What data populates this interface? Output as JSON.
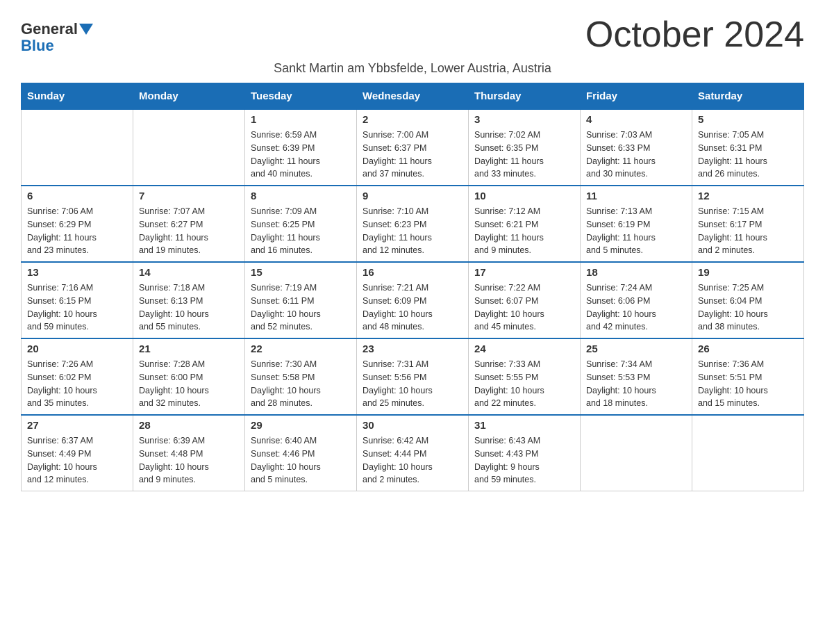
{
  "header": {
    "logo_line1": "General",
    "logo_line2": "Blue",
    "month_title": "October 2024",
    "subtitle": "Sankt Martin am Ybbsfelde, Lower Austria, Austria"
  },
  "weekdays": [
    "Sunday",
    "Monday",
    "Tuesday",
    "Wednesday",
    "Thursday",
    "Friday",
    "Saturday"
  ],
  "weeks": [
    [
      {
        "day": "",
        "info": ""
      },
      {
        "day": "",
        "info": ""
      },
      {
        "day": "1",
        "info": "Sunrise: 6:59 AM\nSunset: 6:39 PM\nDaylight: 11 hours\nand 40 minutes."
      },
      {
        "day": "2",
        "info": "Sunrise: 7:00 AM\nSunset: 6:37 PM\nDaylight: 11 hours\nand 37 minutes."
      },
      {
        "day": "3",
        "info": "Sunrise: 7:02 AM\nSunset: 6:35 PM\nDaylight: 11 hours\nand 33 minutes."
      },
      {
        "day": "4",
        "info": "Sunrise: 7:03 AM\nSunset: 6:33 PM\nDaylight: 11 hours\nand 30 minutes."
      },
      {
        "day": "5",
        "info": "Sunrise: 7:05 AM\nSunset: 6:31 PM\nDaylight: 11 hours\nand 26 minutes."
      }
    ],
    [
      {
        "day": "6",
        "info": "Sunrise: 7:06 AM\nSunset: 6:29 PM\nDaylight: 11 hours\nand 23 minutes."
      },
      {
        "day": "7",
        "info": "Sunrise: 7:07 AM\nSunset: 6:27 PM\nDaylight: 11 hours\nand 19 minutes."
      },
      {
        "day": "8",
        "info": "Sunrise: 7:09 AM\nSunset: 6:25 PM\nDaylight: 11 hours\nand 16 minutes."
      },
      {
        "day": "9",
        "info": "Sunrise: 7:10 AM\nSunset: 6:23 PM\nDaylight: 11 hours\nand 12 minutes."
      },
      {
        "day": "10",
        "info": "Sunrise: 7:12 AM\nSunset: 6:21 PM\nDaylight: 11 hours\nand 9 minutes."
      },
      {
        "day": "11",
        "info": "Sunrise: 7:13 AM\nSunset: 6:19 PM\nDaylight: 11 hours\nand 5 minutes."
      },
      {
        "day": "12",
        "info": "Sunrise: 7:15 AM\nSunset: 6:17 PM\nDaylight: 11 hours\nand 2 minutes."
      }
    ],
    [
      {
        "day": "13",
        "info": "Sunrise: 7:16 AM\nSunset: 6:15 PM\nDaylight: 10 hours\nand 59 minutes."
      },
      {
        "day": "14",
        "info": "Sunrise: 7:18 AM\nSunset: 6:13 PM\nDaylight: 10 hours\nand 55 minutes."
      },
      {
        "day": "15",
        "info": "Sunrise: 7:19 AM\nSunset: 6:11 PM\nDaylight: 10 hours\nand 52 minutes."
      },
      {
        "day": "16",
        "info": "Sunrise: 7:21 AM\nSunset: 6:09 PM\nDaylight: 10 hours\nand 48 minutes."
      },
      {
        "day": "17",
        "info": "Sunrise: 7:22 AM\nSunset: 6:07 PM\nDaylight: 10 hours\nand 45 minutes."
      },
      {
        "day": "18",
        "info": "Sunrise: 7:24 AM\nSunset: 6:06 PM\nDaylight: 10 hours\nand 42 minutes."
      },
      {
        "day": "19",
        "info": "Sunrise: 7:25 AM\nSunset: 6:04 PM\nDaylight: 10 hours\nand 38 minutes."
      }
    ],
    [
      {
        "day": "20",
        "info": "Sunrise: 7:26 AM\nSunset: 6:02 PM\nDaylight: 10 hours\nand 35 minutes."
      },
      {
        "day": "21",
        "info": "Sunrise: 7:28 AM\nSunset: 6:00 PM\nDaylight: 10 hours\nand 32 minutes."
      },
      {
        "day": "22",
        "info": "Sunrise: 7:30 AM\nSunset: 5:58 PM\nDaylight: 10 hours\nand 28 minutes."
      },
      {
        "day": "23",
        "info": "Sunrise: 7:31 AM\nSunset: 5:56 PM\nDaylight: 10 hours\nand 25 minutes."
      },
      {
        "day": "24",
        "info": "Sunrise: 7:33 AM\nSunset: 5:55 PM\nDaylight: 10 hours\nand 22 minutes."
      },
      {
        "day": "25",
        "info": "Sunrise: 7:34 AM\nSunset: 5:53 PM\nDaylight: 10 hours\nand 18 minutes."
      },
      {
        "day": "26",
        "info": "Sunrise: 7:36 AM\nSunset: 5:51 PM\nDaylight: 10 hours\nand 15 minutes."
      }
    ],
    [
      {
        "day": "27",
        "info": "Sunrise: 6:37 AM\nSunset: 4:49 PM\nDaylight: 10 hours\nand 12 minutes."
      },
      {
        "day": "28",
        "info": "Sunrise: 6:39 AM\nSunset: 4:48 PM\nDaylight: 10 hours\nand 9 minutes."
      },
      {
        "day": "29",
        "info": "Sunrise: 6:40 AM\nSunset: 4:46 PM\nDaylight: 10 hours\nand 5 minutes."
      },
      {
        "day": "30",
        "info": "Sunrise: 6:42 AM\nSunset: 4:44 PM\nDaylight: 10 hours\nand 2 minutes."
      },
      {
        "day": "31",
        "info": "Sunrise: 6:43 AM\nSunset: 4:43 PM\nDaylight: 9 hours\nand 59 minutes."
      },
      {
        "day": "",
        "info": ""
      },
      {
        "day": "",
        "info": ""
      }
    ]
  ]
}
